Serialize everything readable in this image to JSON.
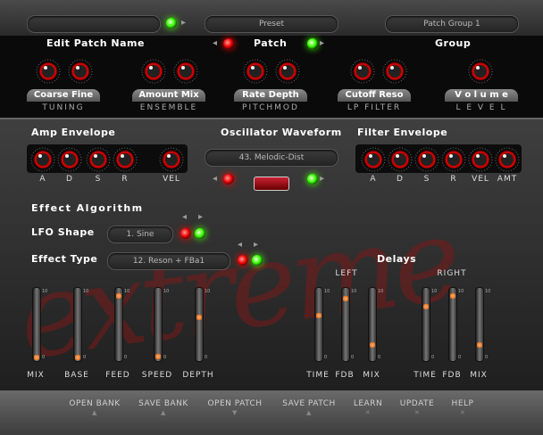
{
  "top": {
    "name_field": "",
    "preset_label": "Preset",
    "patch_group_label": "Patch Group 1",
    "edit_patch_name": "Edit Patch Name",
    "patch_label": "Patch",
    "group_label": "Group"
  },
  "tabs": [
    {
      "title": "Coarse Fine",
      "sub": "TUNING"
    },
    {
      "title": "Amount Mix",
      "sub": "ENSEMBLE"
    },
    {
      "title": "Rate Depth",
      "sub": "PITCHMOD"
    },
    {
      "title": "Cutoff Reso",
      "sub": "LP FILTER"
    },
    {
      "title": "V o l u m e",
      "sub": "L E V E L"
    }
  ],
  "amp": {
    "title": "Amp Envelope",
    "labels": [
      "A",
      "D",
      "S",
      "R",
      "VEL"
    ]
  },
  "osc": {
    "title": "Oscillator Waveform",
    "value": "43. Melodic-Dist"
  },
  "filter": {
    "title": "Filter Envelope",
    "labels": [
      "A",
      "D",
      "S",
      "R",
      "VEL",
      "AMT"
    ]
  },
  "effect": {
    "algorithm_label": "Effect Algorithm",
    "lfo_label": "LFO Shape",
    "lfo_value": "1. Sine",
    "type_label": "Effect Type",
    "type_value": "12. Reson + FBa1",
    "delays_label": "Delays",
    "left_label": "LEFT",
    "right_label": "RIGHT"
  },
  "fx_sliders": {
    "labels": [
      "MIX",
      "BASE",
      "FEED",
      "SPEED",
      "DEPTH"
    ],
    "levels": [
      0.02,
      0.02,
      0.95,
      0.03,
      0.62
    ]
  },
  "left_sliders": {
    "labels": [
      "TIME",
      "FDB",
      "MIX"
    ],
    "levels": [
      0.65,
      0.9,
      0.2
    ]
  },
  "right_sliders": {
    "labels": [
      "TIME",
      "FDB",
      "MIX"
    ],
    "levels": [
      0.78,
      0.95,
      0.2
    ]
  },
  "watermark": "extreme",
  "bottom": [
    {
      "label": "OPEN BANK",
      "icon": "▲"
    },
    {
      "label": "SAVE BANK",
      "icon": "▲"
    },
    {
      "label": "OPEN PATCH",
      "icon": "▼"
    },
    {
      "label": "SAVE PATCH",
      "icon": "▲"
    },
    {
      "label": "LEARN",
      "icon": "✕"
    },
    {
      "label": "UPDATE",
      "icon": "✕"
    },
    {
      "label": "HELP",
      "icon": "✕"
    }
  ]
}
